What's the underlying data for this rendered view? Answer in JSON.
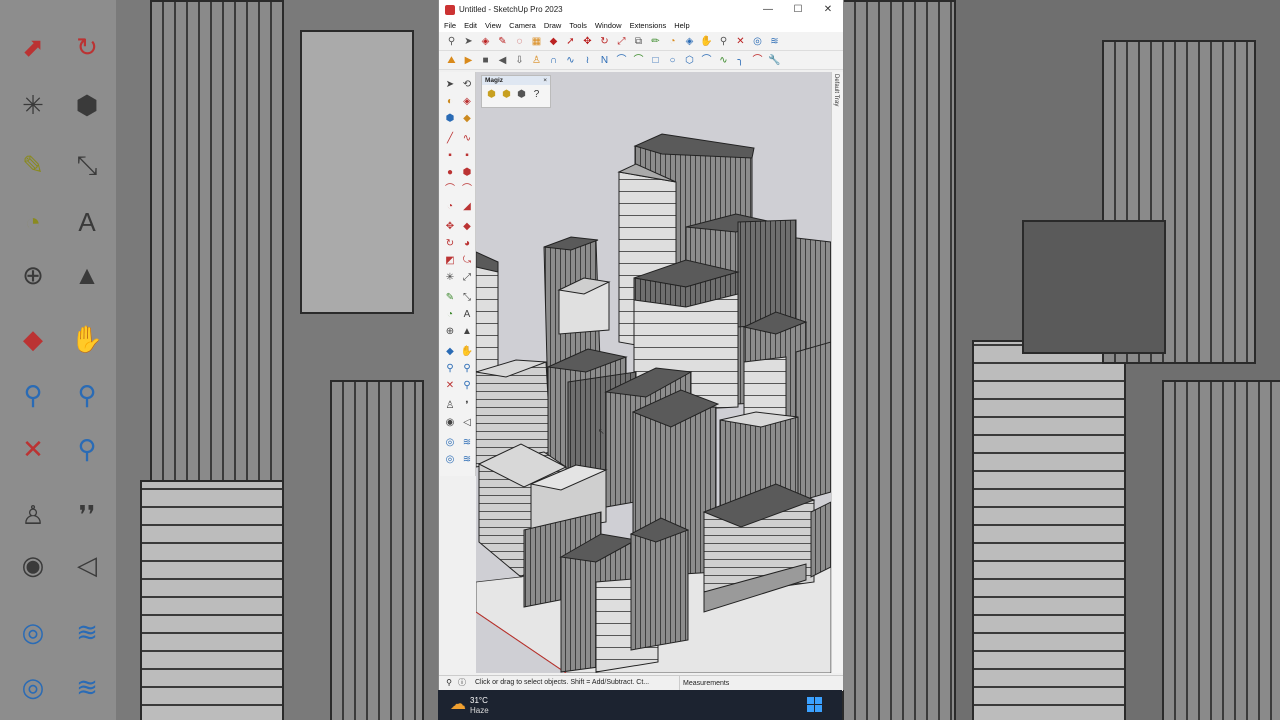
{
  "window": {
    "title": "Untitled - SketchUp Pro 2023",
    "controls": [
      "—",
      "☐",
      "✕"
    ]
  },
  "menu": [
    "File",
    "Edit",
    "View",
    "Camera",
    "Draw",
    "Tools",
    "Window",
    "Extensions",
    "Help"
  ],
  "toolbar": {
    "row1_icons": [
      "search-icon",
      "select-icon",
      "dropdown",
      "eraser-icon",
      "pencil-icon",
      "dropdown",
      "lasso-icon",
      "dropdown",
      "paint-icon",
      "dropdown",
      "push-pull-icon",
      "follow-me-icon",
      "move-icon",
      "rotate-icon",
      "scale-icon",
      "offset-icon",
      "tape-icon",
      "protractor-icon",
      "orbit-icon",
      "pan-icon",
      "zoom-icon",
      "zoom-extents-icon",
      "walk-icon",
      "section-icon"
    ],
    "row2_icons": [
      "sandbox-icon",
      "play-icon",
      "stop-icon",
      "back-icon",
      "push-icon",
      "person-icon",
      "curve-icon",
      "spline-icon",
      "freehand-icon",
      "arc-icon",
      "circle-icon",
      "polygon-icon",
      "arc2-icon",
      "bezier-icon",
      "fillet-icon",
      "extend-icon",
      "pipe-icon",
      "join-icon",
      "vertex-icon",
      "wrench-icon"
    ]
  },
  "magiz_panel": {
    "title": "Magiz",
    "close": "×",
    "buttons": [
      "box-icon",
      "box-gear-icon",
      "cube-icon",
      "help-icon"
    ]
  },
  "tray": {
    "label": "Default Tray"
  },
  "statusbar": {
    "message": "Click or drag to select objects. Shift = Add/Subtract. Ct...",
    "measurements_label": "Measurements"
  },
  "taskbar": {
    "temperature": "31°C",
    "condition": "Haze"
  },
  "colors": {
    "sky": "#cfcfd4",
    "ground": "#e6e6e6",
    "building_top": "#5a5a5a",
    "building_side": "#8c8c8c",
    "accent_red": "#c0302a",
    "accent_blue": "#2a6bb5"
  }
}
